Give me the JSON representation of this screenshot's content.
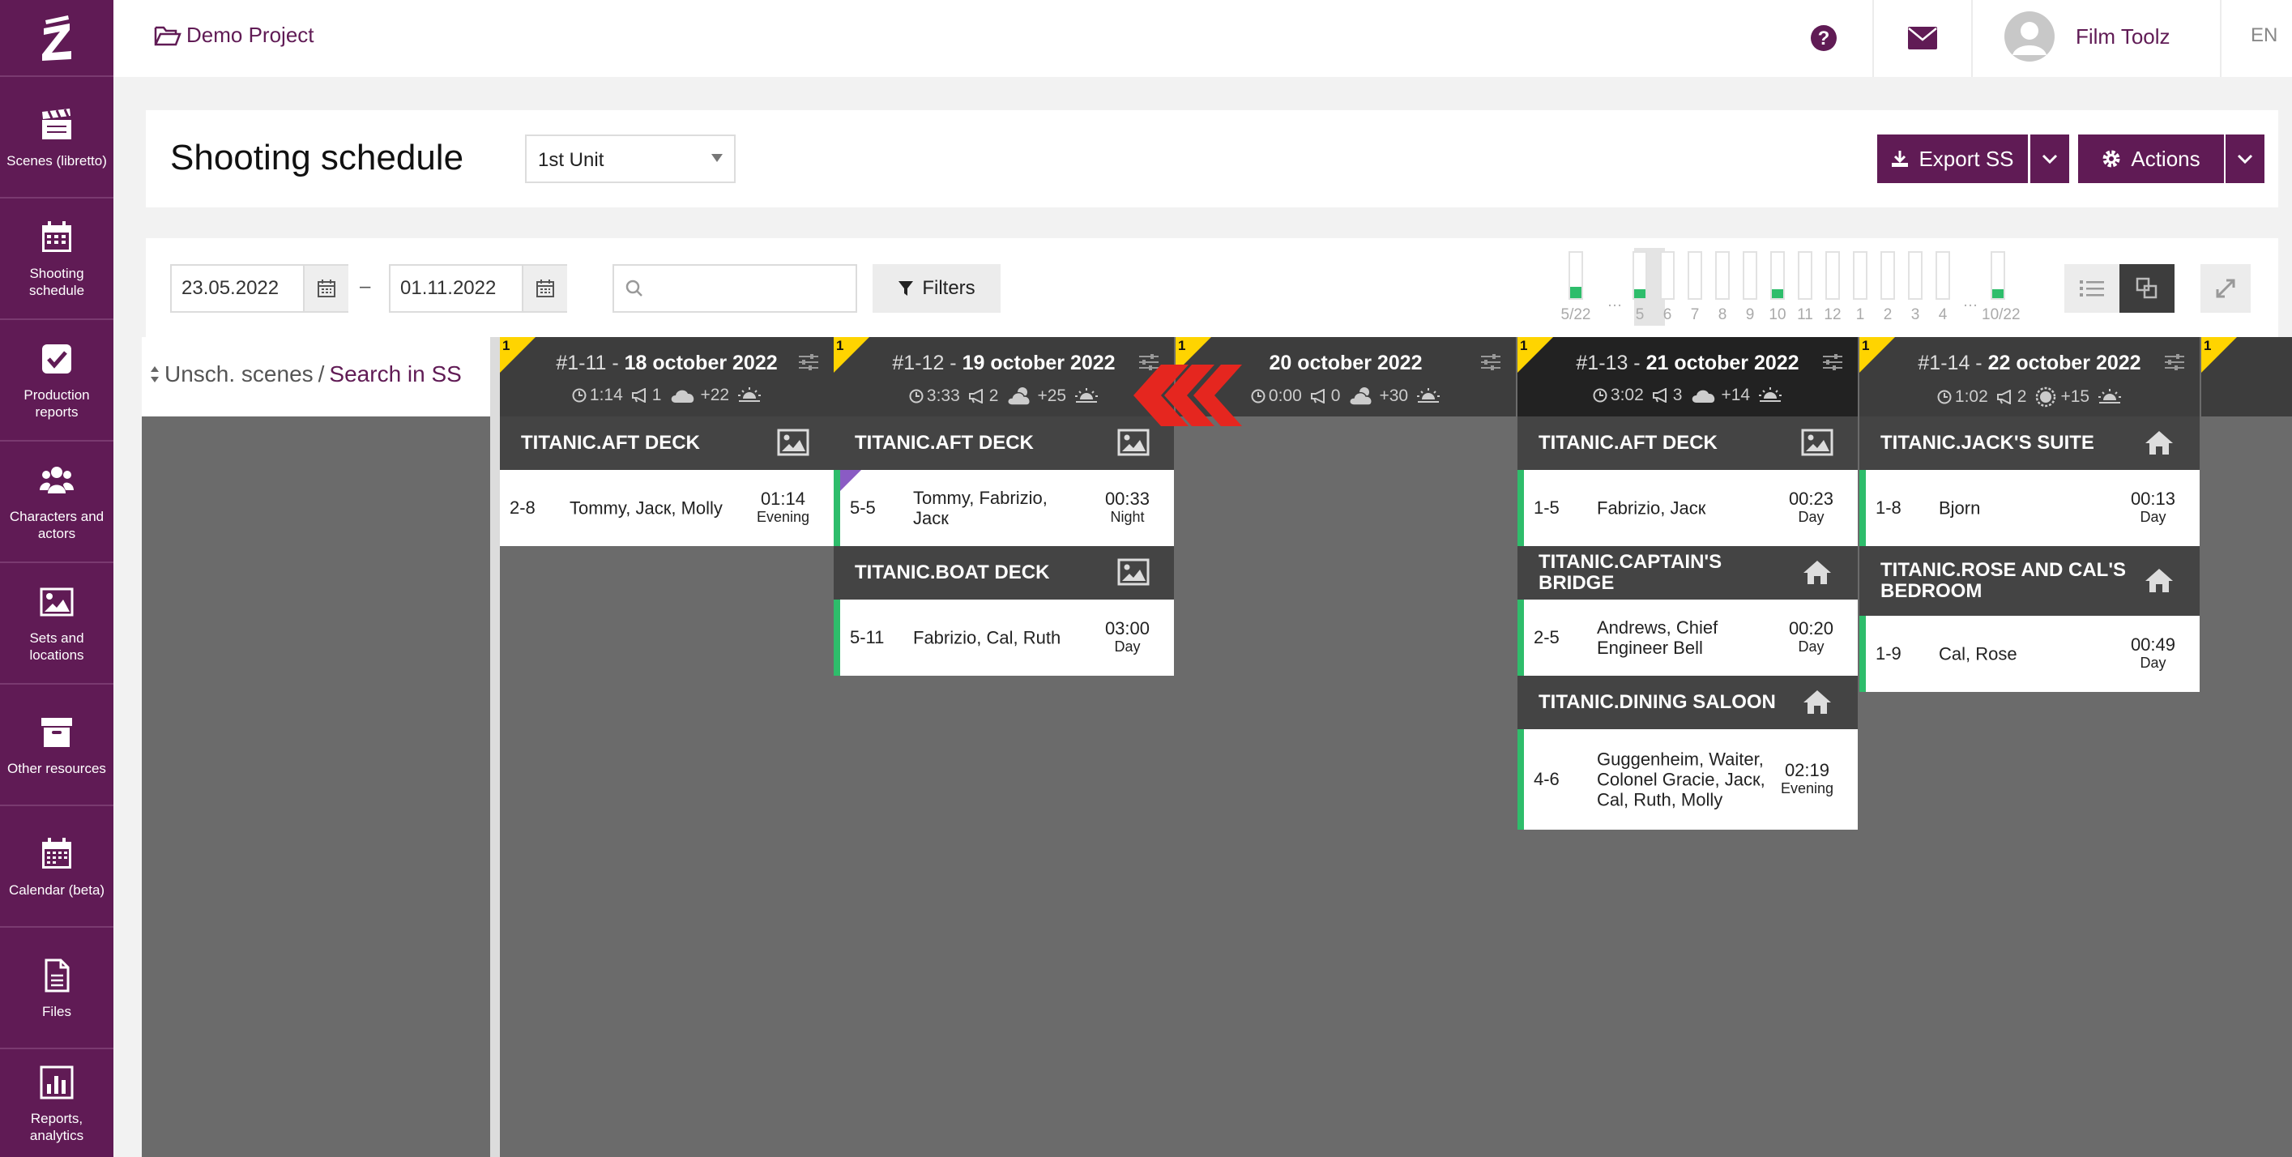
{
  "colors": {
    "brand": "#601b55",
    "accent_green": "#2ebd6b",
    "badge_yellow": "#ffd400",
    "arrow_red": "#e5261f"
  },
  "sidebar": {
    "items": [
      {
        "label": "Scenes (libretto)",
        "icon": "clapperboard-icon"
      },
      {
        "label": "Shooting schedule",
        "icon": "calendar-icon"
      },
      {
        "label": "Production reports",
        "icon": "check-square-icon"
      },
      {
        "label": "Characters and actors",
        "icon": "users-icon"
      },
      {
        "label": "Sets and locations",
        "icon": "image-icon"
      },
      {
        "label": "Other resources",
        "icon": "archive-icon"
      },
      {
        "label": "Calendar (beta)",
        "icon": "calendar-grid-icon"
      },
      {
        "label": "Files",
        "icon": "file-icon"
      },
      {
        "label": "Reports, analytics",
        "icon": "bar-chart-icon"
      }
    ]
  },
  "topbar": {
    "project": "Demo Project",
    "user": "Film Toolz",
    "lang": "EN"
  },
  "header": {
    "title": "Shooting schedule",
    "unit_select": "1st Unit",
    "export_label": "Export SS",
    "actions_label": "Actions"
  },
  "toolbar": {
    "date_from": "23.05.2022",
    "date_sep": "–",
    "date_to": "01.11.2022",
    "search_placeholder": "",
    "filters_label": "Filters"
  },
  "day_strip": {
    "labels": [
      "5/22",
      "…",
      "5",
      "6",
      "7",
      "8",
      "9",
      "10",
      "11",
      "12",
      "1",
      "2",
      "3",
      "4",
      "…",
      "10/22"
    ],
    "fills": [
      0.25,
      null,
      0.2,
      0,
      0,
      0,
      0,
      0.2,
      0,
      0,
      0,
      0,
      0,
      0,
      null,
      0.2
    ]
  },
  "left_panel": {
    "unscheduled": "Unsch. scenes",
    "slash": "/",
    "search_in_ss": "Search in SS"
  },
  "days": [
    {
      "badge": "1",
      "num": "#1-11 -",
      "date": "18 october 2022",
      "duration": "1:14",
      "pages": "1",
      "weather": "cloud",
      "temp": "+22",
      "sets": [
        {
          "name": "TITANIC.AFT DECK",
          "icon": "image",
          "scenes": [
            {
              "no": "2-8",
              "cast": "Tommy, Jacк, Molly",
              "time": "01:14",
              "dn": "Evening",
              "bar": false
            }
          ]
        }
      ]
    },
    {
      "badge": "1",
      "num": "#1-12 -",
      "date": "19 october 2022",
      "duration": "3:33",
      "pages": "2",
      "weather": "partly-cloudy",
      "temp": "+25",
      "sets": [
        {
          "name": "TITANIC.AFT DECK",
          "icon": "image",
          "scenes": [
            {
              "no": "5-5",
              "cast": "Tommy, Fabrizio, Jacк",
              "time": "00:33",
              "dn": "Night",
              "bar": true,
              "corner": true
            }
          ]
        },
        {
          "name": "TITANIC.BOAT DECK",
          "icon": "image",
          "scenes": [
            {
              "no": "5-11",
              "cast": "Fabrizio, Cal, Ruth",
              "time": "03:00",
              "dn": "Day",
              "bar": true
            }
          ]
        }
      ]
    },
    {
      "badge": "1",
      "num": "",
      "date": "20 october 2022",
      "duration": "0:00",
      "pages": "0",
      "weather": "partly-cloudy",
      "temp": "+30",
      "sets": []
    },
    {
      "badge": "1",
      "num": "#1-13 -",
      "date": "21 october 2022",
      "duration": "3:02",
      "pages": "3",
      "weather": "cloud",
      "temp": "+14",
      "selected": true,
      "sets": [
        {
          "name": "TITANIC.AFT DECK",
          "icon": "image",
          "scenes": [
            {
              "no": "1-5",
              "cast": "Fabrizio, Jacк",
              "time": "00:23",
              "dn": "Day",
              "bar": true
            }
          ]
        },
        {
          "name": "TITANIC.CAPTAIN'S BRIDGE",
          "icon": "home",
          "scenes": [
            {
              "no": "2-5",
              "cast": "Andrews, Chief Engineer Bell",
              "time": "00:20",
              "dn": "Day",
              "bar": true
            }
          ]
        },
        {
          "name": "TITANIC.DINING SALOON",
          "icon": "home",
          "scenes": [
            {
              "no": "4-6",
              "cast": "Guggenheim, Waiter, Colonel Gracie, Jacк, Cal, Ruth, Molly",
              "time": "02:19",
              "dn": "Evening",
              "bar": true
            }
          ]
        }
      ]
    },
    {
      "badge": "1",
      "num": "#1-14 -",
      "date": "22 october 2022",
      "duration": "1:02",
      "pages": "2",
      "weather": "sun",
      "temp": "+15",
      "sets": [
        {
          "name": "TITANIC.JACK'S SUITE",
          "icon": "home",
          "scenes": [
            {
              "no": "1-8",
              "cast": "Bjorn",
              "time": "00:13",
              "dn": "Day",
              "bar": true
            }
          ]
        },
        {
          "name": "TITANIC.ROSE AND CAL'S BEDROOM",
          "icon": "home",
          "scenes": [
            {
              "no": "1-9",
              "cast": "Cal, Rose",
              "time": "00:49",
              "dn": "Day",
              "bar": true
            }
          ]
        }
      ]
    },
    {
      "badge": "1"
    }
  ]
}
